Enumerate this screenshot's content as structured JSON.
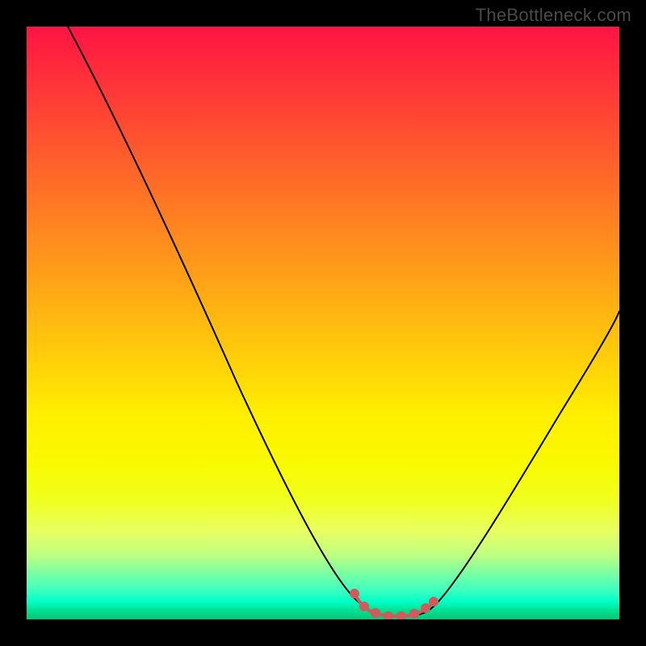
{
  "watermark": "TheBottleneck.com",
  "chart_data": {
    "type": "line",
    "title": "",
    "xlabel": "",
    "ylabel": "",
    "xlim": [
      0,
      100
    ],
    "ylim": [
      0,
      100
    ],
    "colors": {
      "top": "#ff1444",
      "mid": "#fff000",
      "bottom": "#00c878",
      "curve": "#000000",
      "marker": "#d15a5a"
    },
    "series": [
      {
        "name": "bottleneck-curve-left",
        "x": [
          7,
          15,
          25,
          35,
          45,
          50,
          55,
          57.5
        ],
        "y": [
          100,
          85,
          65,
          45,
          25,
          12,
          4,
          1
        ]
      },
      {
        "name": "minimum-plateau",
        "x": [
          57.5,
          60,
          63,
          66,
          68
        ],
        "y": [
          1,
          0.5,
          0.5,
          0.7,
          1
        ]
      },
      {
        "name": "bottleneck-curve-right",
        "x": [
          68,
          72,
          78,
          85,
          92,
          100
        ],
        "y": [
          1,
          4,
          12,
          25,
          38,
          52
        ]
      }
    ],
    "markers": {
      "name": "optimal-zone",
      "x": [
        55,
        57,
        59,
        61,
        63,
        65,
        67,
        68
      ],
      "y": [
        4,
        2,
        1,
        0.7,
        0.7,
        1,
        1.5,
        2
      ]
    }
  }
}
